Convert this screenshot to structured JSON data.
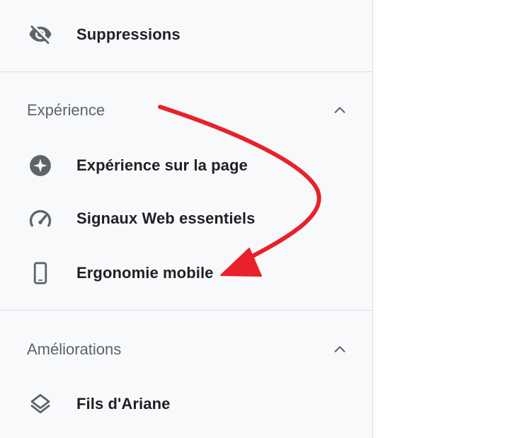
{
  "sidebar": {
    "top_item": {
      "label": "Suppressions",
      "icon": "eye-off-icon"
    },
    "sections": [
      {
        "title": "Expérience",
        "expanded": true,
        "items": [
          {
            "label": "Expérience sur la page",
            "icon": "star-circle-icon"
          },
          {
            "label": "Signaux Web essentiels",
            "icon": "speed-gauge-icon"
          },
          {
            "label": "Ergonomie mobile",
            "icon": "smartphone-icon"
          }
        ]
      },
      {
        "title": "Améliorations",
        "expanded": true,
        "items": [
          {
            "label": "Fils d'Ariane",
            "icon": "layers-icon"
          }
        ]
      }
    ]
  },
  "colors": {
    "sidebar_bg": "#f8f9fa",
    "divider": "#dadce0",
    "label_text": "#202124",
    "section_text": "#5f6368",
    "icon": "#5f6368",
    "annotation_arrow": "#e8212a"
  }
}
